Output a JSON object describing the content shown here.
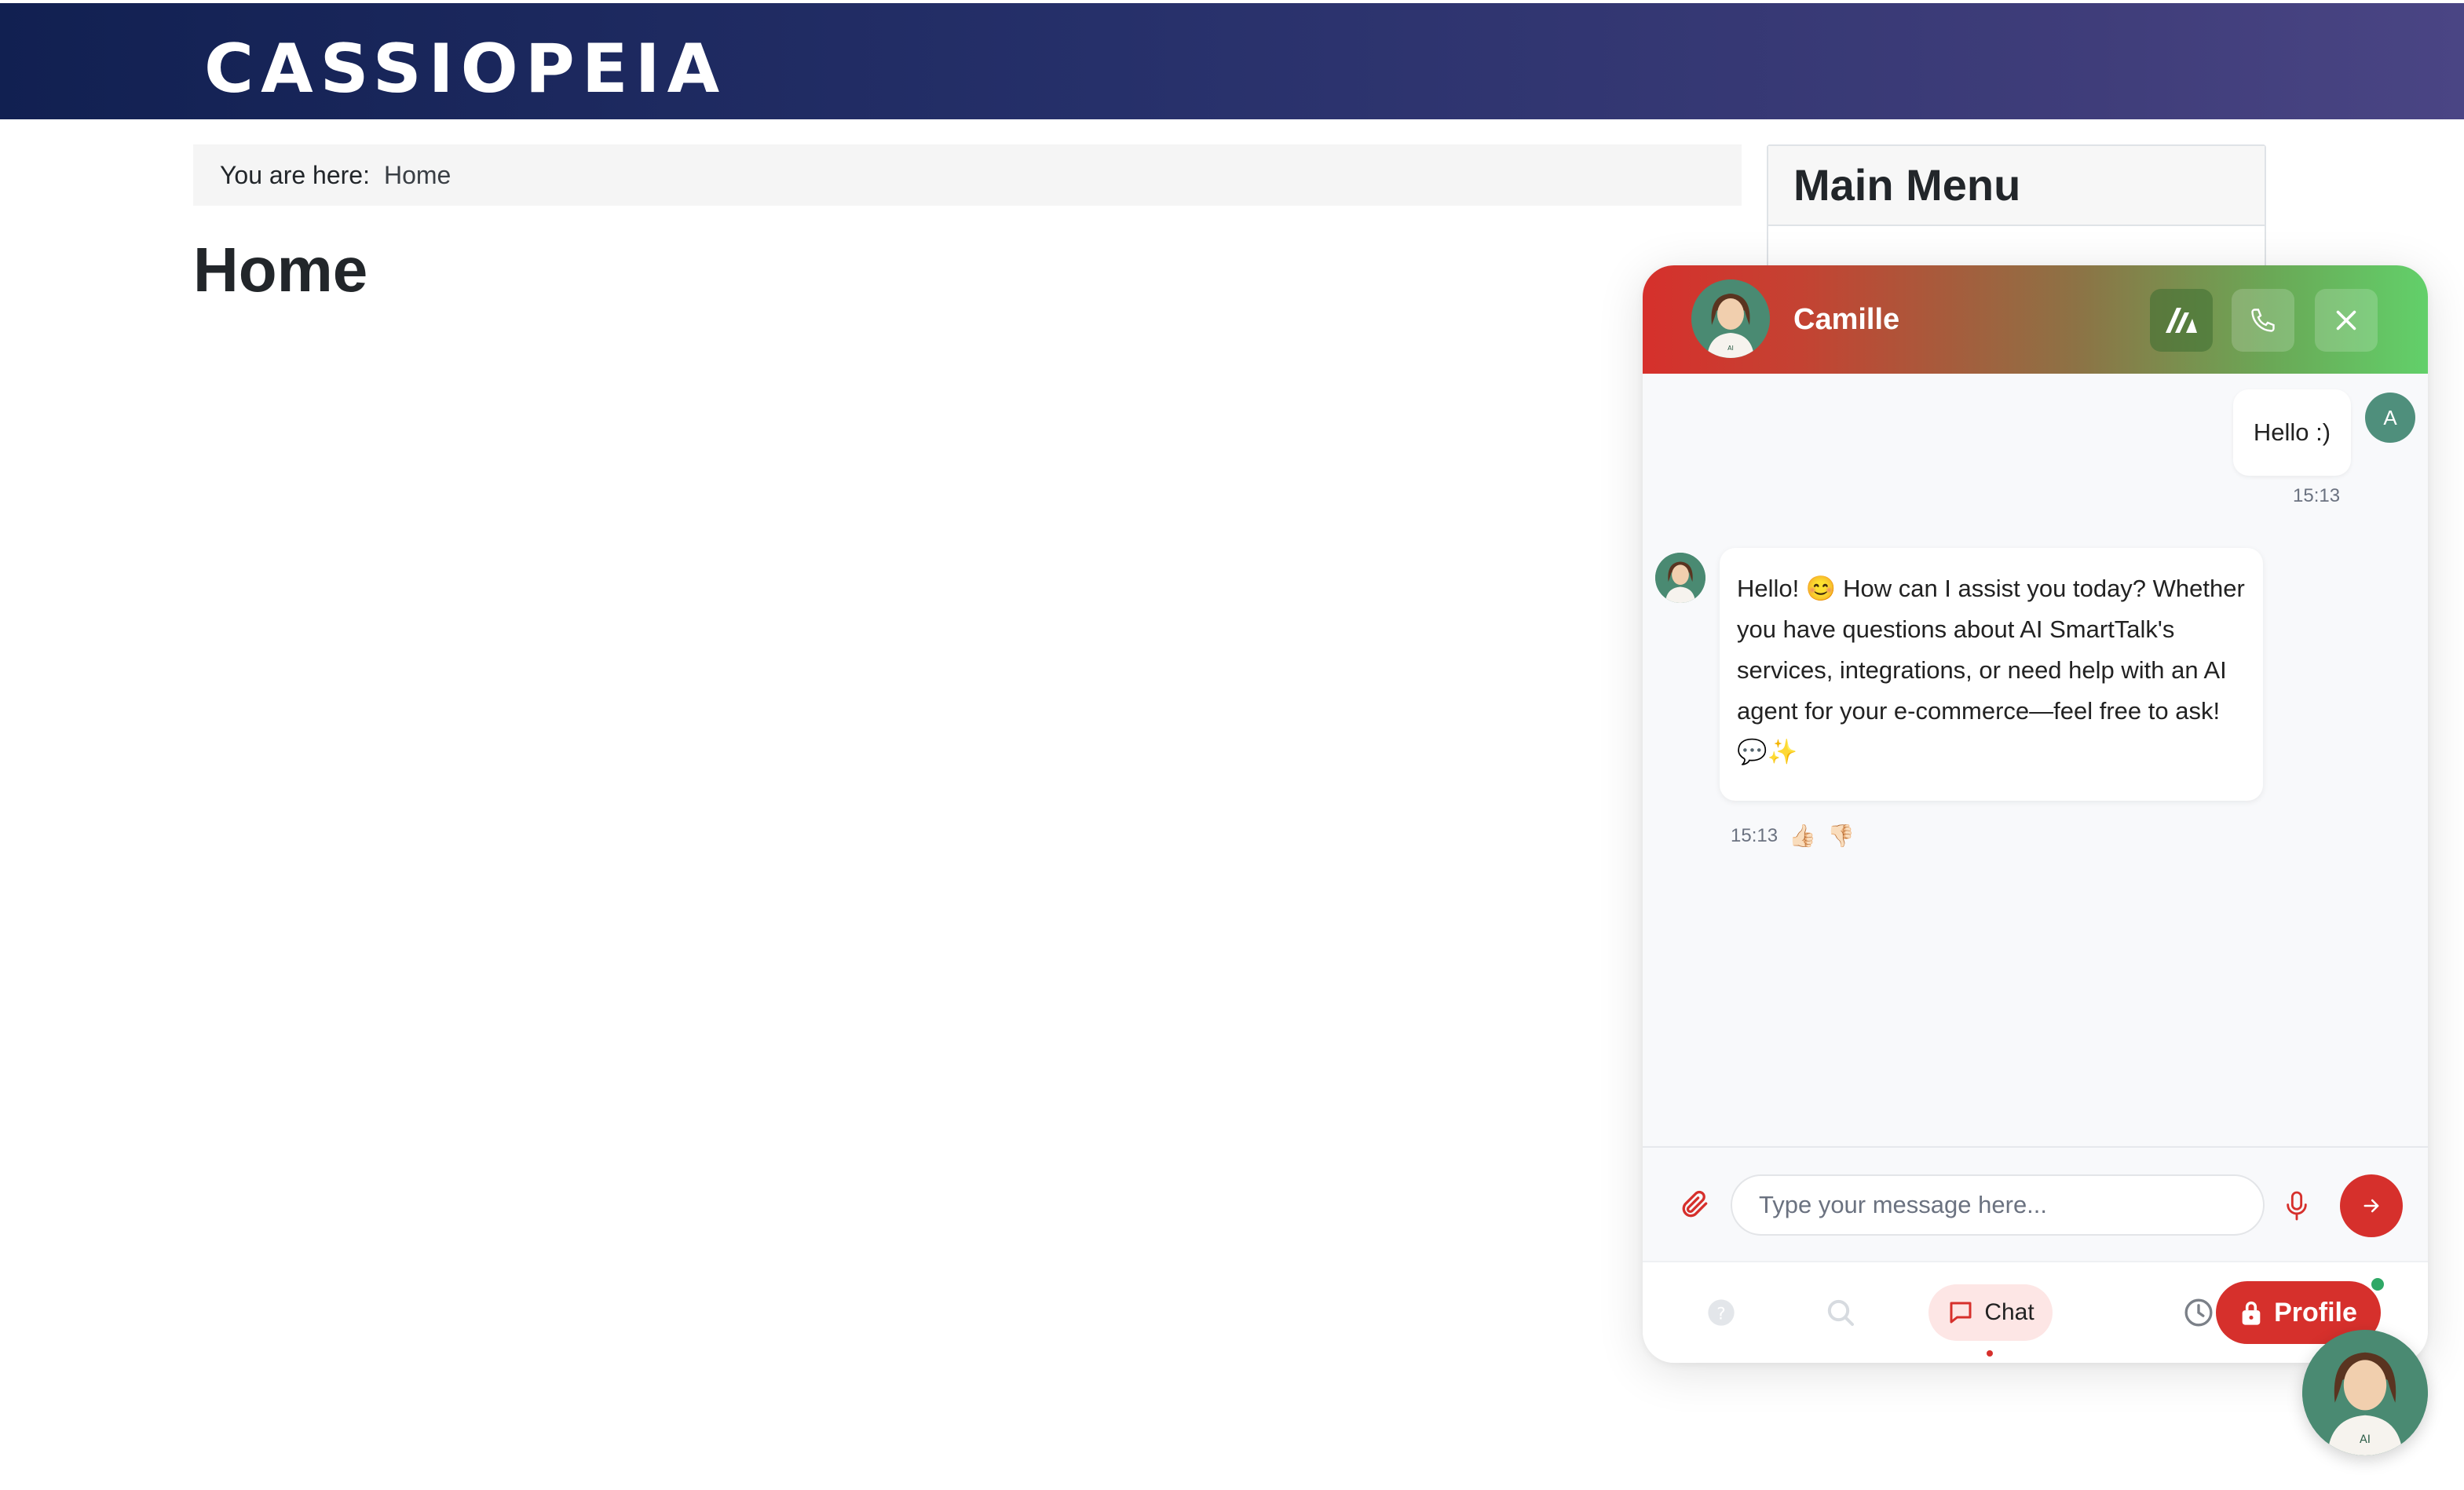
{
  "site": {
    "brand": "CASSIOPEIA",
    "breadcrumb_prefix": "You are here:",
    "breadcrumb_current": "Home",
    "page_title": "Home",
    "sidebar_title": "Main Menu"
  },
  "chat": {
    "agent_name": "Camille",
    "user_initial": "A",
    "messages": [
      {
        "from": "user",
        "text": "Hello :)",
        "time": "15:13"
      },
      {
        "from": "agent",
        "text": "Hello! 😊 How can I assist you today? Whether you have questions about AI SmartTalk's services, integrations, or need help with an AI agent for your e-commerce—feel free to ask! 💬✨",
        "time": "15:13"
      }
    ],
    "thumbs_up": "👍🏻",
    "thumbs_down": "👎🏻",
    "input_placeholder": "Type your message here...",
    "tab_chat_label": "Chat",
    "profile_label": "Profile",
    "avatar_badge": "AI"
  },
  "colors": {
    "header_dark": "#112051",
    "accent_red": "#d6302c",
    "accent_green": "#62d06a",
    "avatar_bg": "#4a8a72"
  }
}
